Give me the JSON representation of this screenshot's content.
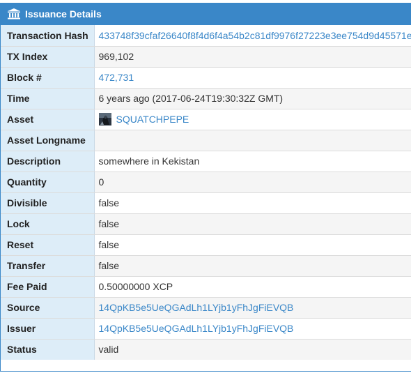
{
  "panel": {
    "title": "Issuance Details",
    "icon": "bank-icon",
    "header_color": "#3a87c8"
  },
  "rows": [
    {
      "label": "Transaction Hash",
      "value": "433748f39cfaf26640f8f4d6f4a54b2c81df9976f27223e3ee754d9d45571e",
      "link": true
    },
    {
      "label": "TX Index",
      "value": "969,102",
      "link": false
    },
    {
      "label": "Block #",
      "value": "472,731",
      "link": true
    },
    {
      "label": "Time",
      "value": "6 years ago (2017-06-24T19:30:32Z GMT)",
      "link": false
    },
    {
      "label": "Asset",
      "value": "SQUATCHPEPE",
      "link": true,
      "icon": "asset-thumbnail-icon"
    },
    {
      "label": "Asset Longname",
      "value": "",
      "link": false
    },
    {
      "label": "Description",
      "value": "somewhere in Kekistan",
      "link": false
    },
    {
      "label": "Quantity",
      "value": "0",
      "link": false
    },
    {
      "label": "Divisible",
      "value": "false",
      "link": false
    },
    {
      "label": "Lock",
      "value": "false",
      "link": false
    },
    {
      "label": "Reset",
      "value": "false",
      "link": false
    },
    {
      "label": "Transfer",
      "value": "false",
      "link": false
    },
    {
      "label": "Fee Paid",
      "value": "0.50000000 XCP",
      "link": false
    },
    {
      "label": "Source",
      "value": "14QpKB5e5UeQGAdLh1LYjb1yFhJgFiEVQB",
      "link": true
    },
    {
      "label": "Issuer",
      "value": "14QpKB5e5UeQGAdLh1LYjb1yFhJgFiEVQB",
      "link": true
    },
    {
      "label": "Status",
      "value": "valid",
      "link": false
    }
  ]
}
